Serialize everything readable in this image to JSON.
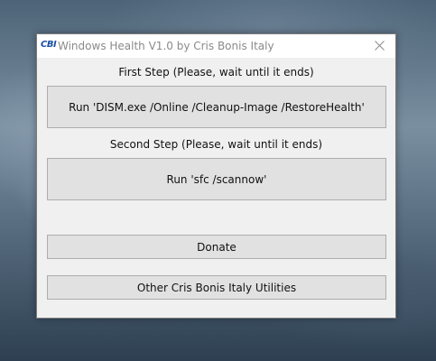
{
  "window": {
    "icon_text": "CBI",
    "title": "Windows Health V1.0 by Cris Bonis Italy",
    "close_icon": "close-icon"
  },
  "steps": {
    "first_label": "First Step (Please, wait until it ends)",
    "first_button": "Run 'DISM.exe /Online /Cleanup-Image /RestoreHealth'",
    "second_label": "Second Step (Please, wait until it ends)",
    "second_button": "Run 'sfc /scannow'"
  },
  "actions": {
    "donate_button": "Donate",
    "other_utilities_button": "Other Cris Bonis Italy Utilities"
  },
  "colors": {
    "icon_accent": "#1d4fa3",
    "window_bg": "#f0f0f0",
    "button_bg": "#e1e1e1",
    "button_border": "#adadad"
  }
}
